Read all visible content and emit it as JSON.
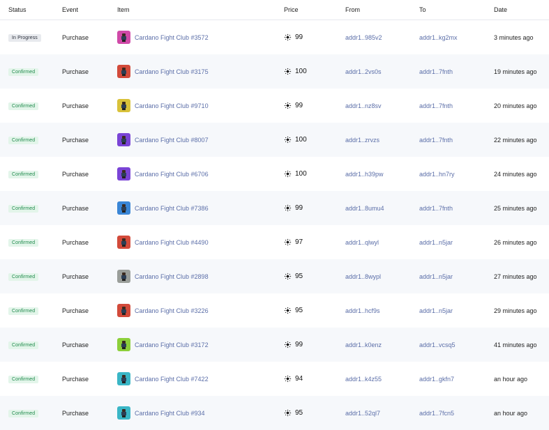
{
  "headers": {
    "status": "Status",
    "event": "Event",
    "item": "Item",
    "price": "Price",
    "from": "From",
    "to": "To",
    "date": "Date"
  },
  "rows": [
    {
      "status": "In Progress",
      "status_kind": "progress",
      "event": "Purchase",
      "item": "Cardano Fight Club #3572",
      "thumb_color": "#d04aa8",
      "price": "99",
      "from": "addr1..985v2",
      "to": "addr1..kg2mx",
      "date": "3 minutes ago"
    },
    {
      "status": "Confirmed",
      "status_kind": "confirmed",
      "event": "Purchase",
      "item": "Cardano Fight Club #3175",
      "thumb_color": "#d24a3a",
      "price": "100",
      "from": "addr1..2vs0s",
      "to": "addr1..7fnth",
      "date": "19 minutes ago"
    },
    {
      "status": "Confirmed",
      "status_kind": "confirmed",
      "event": "Purchase",
      "item": "Cardano Fight Club #9710",
      "thumb_color": "#d9c23a",
      "price": "99",
      "from": "addr1..nz8sv",
      "to": "addr1..7fnth",
      "date": "20 minutes ago"
    },
    {
      "status": "Confirmed",
      "status_kind": "confirmed",
      "event": "Purchase",
      "item": "Cardano Fight Club #8007",
      "thumb_color": "#7a44d6",
      "price": "100",
      "from": "addr1..zrvzs",
      "to": "addr1..7fnth",
      "date": "22 minutes ago"
    },
    {
      "status": "Confirmed",
      "status_kind": "confirmed",
      "event": "Purchase",
      "item": "Cardano Fight Club #6706",
      "thumb_color": "#7a44d6",
      "price": "100",
      "from": "addr1..h39pw",
      "to": "addr1..hn7ry",
      "date": "24 minutes ago"
    },
    {
      "status": "Confirmed",
      "status_kind": "confirmed",
      "event": "Purchase",
      "item": "Cardano Fight Club #7386",
      "thumb_color": "#3a86d6",
      "price": "99",
      "from": "addr1..8umu4",
      "to": "addr1..7fnth",
      "date": "25 minutes ago"
    },
    {
      "status": "Confirmed",
      "status_kind": "confirmed",
      "event": "Purchase",
      "item": "Cardano Fight Club #4490",
      "thumb_color": "#d24a3a",
      "price": "97",
      "from": "addr1..qlwyl",
      "to": "addr1..n5jar",
      "date": "26 minutes ago"
    },
    {
      "status": "Confirmed",
      "status_kind": "confirmed",
      "event": "Purchase",
      "item": "Cardano Fight Club #2898",
      "thumb_color": "#9a9e9a",
      "price": "95",
      "from": "addr1..8wypl",
      "to": "addr1..n5jar",
      "date": "27 minutes ago"
    },
    {
      "status": "Confirmed",
      "status_kind": "confirmed",
      "event": "Purchase",
      "item": "Cardano Fight Club #3226",
      "thumb_color": "#d24a3a",
      "price": "95",
      "from": "addr1..hcf9s",
      "to": "addr1..n5jar",
      "date": "29 minutes ago"
    },
    {
      "status": "Confirmed",
      "status_kind": "confirmed",
      "event": "Purchase",
      "item": "Cardano Fight Club #3172",
      "thumb_color": "#8ccf3a",
      "price": "99",
      "from": "addr1..k0enz",
      "to": "addr1..vcsq5",
      "date": "41 minutes ago"
    },
    {
      "status": "Confirmed",
      "status_kind": "confirmed",
      "event": "Purchase",
      "item": "Cardano Fight Club #7422",
      "thumb_color": "#3ab6c6",
      "price": "94",
      "from": "addr1..k4z55",
      "to": "addr1..gkfn7",
      "date": "an hour ago"
    },
    {
      "status": "Confirmed",
      "status_kind": "confirmed",
      "event": "Purchase",
      "item": "Cardano Fight Club #934",
      "thumb_color": "#3ab6c6",
      "price": "95",
      "from": "addr1..52ql7",
      "to": "addr1..7fcn5",
      "date": "an hour ago"
    }
  ],
  "icons": {
    "currency": "ada-currency-icon"
  }
}
